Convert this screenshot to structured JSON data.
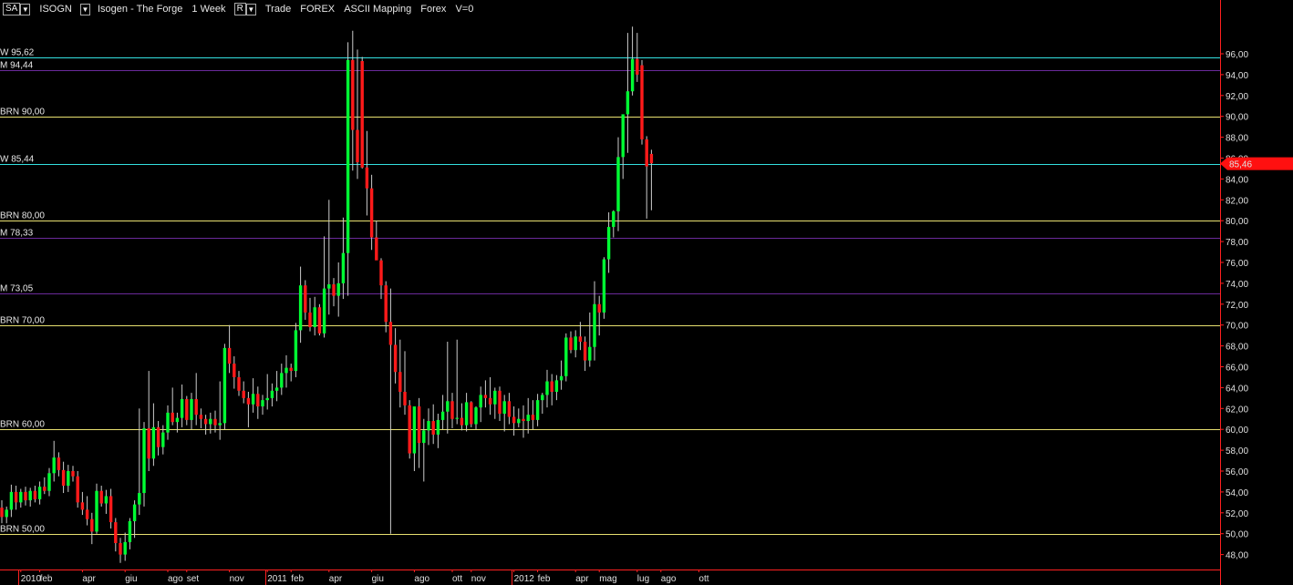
{
  "toolbar": {
    "sa_label": "SA",
    "symbol": "ISOGN",
    "description": "Isogen - The Forge",
    "period": "1 Week",
    "r_label": "R",
    "trade": "Trade",
    "market": "FOREX",
    "mapping": "ASCII Mapping",
    "forex": "Forex",
    "volume": "V=0",
    "dropdown_icon": "chevron-down-icon"
  },
  "colors": {
    "background": "#000000",
    "up_candle": "#00ff33",
    "down_candle": "#ff1a1a",
    "wick": "#cccccc",
    "weekly_level": "#33e0e0",
    "monthly_level": "#6a2a9a",
    "brn_level": "#e8e070",
    "axis": "#ff2020",
    "last_price_bg": "#ff1010"
  },
  "chart_data": {
    "type": "candlestick",
    "ylim": [
      47,
      100
    ],
    "yticks": [
      "48,00",
      "50,00",
      "52,00",
      "54,00",
      "56,00",
      "58,00",
      "60,00",
      "62,00",
      "64,00",
      "66,00",
      "68,00",
      "70,00",
      "72,00",
      "74,00",
      "76,00",
      "78,00",
      "80,00",
      "82,00",
      "84,00",
      "86,00",
      "88,00",
      "90,00",
      "92,00",
      "94,00",
      "96,00"
    ],
    "x_labels": [
      {
        "label": "2010",
        "w": 4
      },
      {
        "label": "feb",
        "w": 8
      },
      {
        "label": "apr",
        "w": 17
      },
      {
        "label": "giu",
        "w": 26
      },
      {
        "label": "ago",
        "w": 35
      },
      {
        "label": "set",
        "w": 39
      },
      {
        "label": "nov",
        "w": 48
      },
      {
        "label": "2011",
        "w": 56
      },
      {
        "label": "feb",
        "w": 61
      },
      {
        "label": "apr",
        "w": 69
      },
      {
        "label": "giu",
        "w": 78
      },
      {
        "label": "ago",
        "w": 87
      },
      {
        "label": "ott",
        "w": 95
      },
      {
        "label": "nov",
        "w": 99
      },
      {
        "label": "2012",
        "w": 108
      },
      {
        "label": "feb",
        "w": 113
      },
      {
        "label": "apr",
        "w": 121
      },
      {
        "label": "mag",
        "w": 126
      },
      {
        "label": "lug",
        "w": 134
      },
      {
        "label": "ago",
        "w": 139
      },
      {
        "label": "ott",
        "w": 147
      }
    ],
    "year_boundaries": [
      4,
      56,
      108
    ],
    "levels": [
      {
        "label": "W 95,62",
        "value": 95.62,
        "kind": "weekly"
      },
      {
        "label": "M 94,44",
        "value": 94.44,
        "kind": "monthly"
      },
      {
        "label": "BRN 90,00",
        "value": 90.0,
        "kind": "brn"
      },
      {
        "label": "W 85,44",
        "value": 85.44,
        "kind": "weekly"
      },
      {
        "label": "BRN 80,00",
        "value": 80.0,
        "kind": "brn"
      },
      {
        "label": "M 78,33",
        "value": 78.33,
        "kind": "monthly"
      },
      {
        "label": "M 73,05",
        "value": 73.05,
        "kind": "monthly"
      },
      {
        "label": "BRN 70,00",
        "value": 70.0,
        "kind": "brn"
      },
      {
        "label": "BRN 60,00",
        "value": 60.0,
        "kind": "brn"
      },
      {
        "label": "BRN 50,00",
        "value": 50.0,
        "kind": "brn"
      }
    ],
    "last_price": {
      "value": 85.46,
      "label": "85,46"
    },
    "candles": [
      {
        "o": 52.5,
        "h": 53.2,
        "l": 51.0,
        "c": 51.6
      },
      {
        "o": 51.6,
        "h": 52.6,
        "l": 51.0,
        "c": 52.3
      },
      {
        "o": 52.3,
        "h": 54.7,
        "l": 51.6,
        "c": 54.0
      },
      {
        "o": 54.0,
        "h": 54.6,
        "l": 52.3,
        "c": 53.0
      },
      {
        "o": 53.0,
        "h": 54.3,
        "l": 52.5,
        "c": 54.0
      },
      {
        "o": 54.0,
        "h": 54.5,
        "l": 52.7,
        "c": 53.2
      },
      {
        "o": 53.2,
        "h": 54.4,
        "l": 52.6,
        "c": 54.1
      },
      {
        "o": 54.1,
        "h": 54.6,
        "l": 53.0,
        "c": 53.3
      },
      {
        "o": 53.3,
        "h": 55.0,
        "l": 52.8,
        "c": 54.5
      },
      {
        "o": 54.5,
        "h": 55.4,
        "l": 53.8,
        "c": 54.1
      },
      {
        "o": 54.1,
        "h": 56.3,
        "l": 53.6,
        "c": 55.8
      },
      {
        "o": 55.8,
        "h": 58.9,
        "l": 55.0,
        "c": 57.3
      },
      {
        "o": 57.3,
        "h": 57.8,
        "l": 55.5,
        "c": 56.1
      },
      {
        "o": 56.1,
        "h": 56.9,
        "l": 53.9,
        "c": 54.6
      },
      {
        "o": 54.6,
        "h": 56.6,
        "l": 54.0,
        "c": 56.0
      },
      {
        "o": 56.0,
        "h": 56.5,
        "l": 55.0,
        "c": 55.5
      },
      {
        "o": 55.5,
        "h": 56.0,
        "l": 52.5,
        "c": 53.0
      },
      {
        "o": 53.0,
        "h": 54.0,
        "l": 51.8,
        "c": 52.3
      },
      {
        "o": 52.3,
        "h": 53.6,
        "l": 50.8,
        "c": 51.4
      },
      {
        "o": 51.4,
        "h": 52.0,
        "l": 49.0,
        "c": 50.2
      },
      {
        "o": 50.2,
        "h": 54.8,
        "l": 50.0,
        "c": 54.1
      },
      {
        "o": 54.1,
        "h": 54.6,
        "l": 52.6,
        "c": 52.9
      },
      {
        "o": 52.9,
        "h": 54.2,
        "l": 51.9,
        "c": 53.6
      },
      {
        "o": 53.6,
        "h": 54.3,
        "l": 50.5,
        "c": 51.1
      },
      {
        "o": 51.1,
        "h": 51.5,
        "l": 48.3,
        "c": 49.1
      },
      {
        "o": 49.1,
        "h": 49.6,
        "l": 47.2,
        "c": 48.0
      },
      {
        "o": 48.0,
        "h": 50.1,
        "l": 47.4,
        "c": 49.2
      },
      {
        "o": 49.2,
        "h": 51.5,
        "l": 48.5,
        "c": 51.2
      },
      {
        "o": 51.2,
        "h": 53.2,
        "l": 49.6,
        "c": 52.8
      },
      {
        "o": 52.8,
        "h": 62.0,
        "l": 51.8,
        "c": 53.9
      },
      {
        "o": 53.9,
        "h": 60.7,
        "l": 52.6,
        "c": 60.1
      },
      {
        "o": 60.1,
        "h": 65.6,
        "l": 56.0,
        "c": 57.2
      },
      {
        "o": 57.2,
        "h": 62.5,
        "l": 56.5,
        "c": 60.2
      },
      {
        "o": 60.2,
        "h": 60.8,
        "l": 57.5,
        "c": 58.3
      },
      {
        "o": 58.3,
        "h": 60.4,
        "l": 57.6,
        "c": 59.7
      },
      {
        "o": 59.7,
        "h": 62.3,
        "l": 59.0,
        "c": 61.6
      },
      {
        "o": 61.6,
        "h": 64.0,
        "l": 60.4,
        "c": 60.7
      },
      {
        "o": 60.7,
        "h": 61.6,
        "l": 59.7,
        "c": 61.1
      },
      {
        "o": 61.1,
        "h": 64.3,
        "l": 60.2,
        "c": 62.9
      },
      {
        "o": 62.9,
        "h": 63.2,
        "l": 60.4,
        "c": 60.9
      },
      {
        "o": 60.9,
        "h": 63.5,
        "l": 60.0,
        "c": 62.9
      },
      {
        "o": 62.9,
        "h": 65.4,
        "l": 60.4,
        "c": 61.4
      },
      {
        "o": 61.4,
        "h": 62.0,
        "l": 60.1,
        "c": 61.0
      },
      {
        "o": 61.0,
        "h": 61.4,
        "l": 59.5,
        "c": 60.5
      },
      {
        "o": 60.5,
        "h": 61.6,
        "l": 59.6,
        "c": 61.0
      },
      {
        "o": 61.0,
        "h": 61.8,
        "l": 59.7,
        "c": 60.4
      },
      {
        "o": 60.4,
        "h": 64.6,
        "l": 59.0,
        "c": 60.6
      },
      {
        "o": 60.6,
        "h": 68.2,
        "l": 60.0,
        "c": 67.8
      },
      {
        "o": 67.8,
        "h": 70.0,
        "l": 65.4,
        "c": 66.3
      },
      {
        "o": 66.3,
        "h": 67.0,
        "l": 63.9,
        "c": 65.0
      },
      {
        "o": 65.0,
        "h": 65.6,
        "l": 63.2,
        "c": 63.7
      },
      {
        "o": 63.7,
        "h": 64.6,
        "l": 62.5,
        "c": 63.0
      },
      {
        "o": 63.0,
        "h": 63.6,
        "l": 60.2,
        "c": 62.4
      },
      {
        "o": 62.4,
        "h": 64.9,
        "l": 61.6,
        "c": 63.4
      },
      {
        "o": 63.4,
        "h": 64.1,
        "l": 61.0,
        "c": 62.2
      },
      {
        "o": 62.2,
        "h": 63.3,
        "l": 61.4,
        "c": 62.8
      },
      {
        "o": 62.8,
        "h": 65.3,
        "l": 61.9,
        "c": 63.0
      },
      {
        "o": 63.0,
        "h": 64.4,
        "l": 62.2,
        "c": 63.7
      },
      {
        "o": 63.7,
        "h": 65.6,
        "l": 62.7,
        "c": 64.0
      },
      {
        "o": 64.0,
        "h": 66.3,
        "l": 63.3,
        "c": 65.4
      },
      {
        "o": 65.4,
        "h": 67.1,
        "l": 64.0,
        "c": 65.9
      },
      {
        "o": 65.9,
        "h": 66.3,
        "l": 64.6,
        "c": 65.6
      },
      {
        "o": 65.6,
        "h": 70.2,
        "l": 65.0,
        "c": 69.5
      },
      {
        "o": 69.5,
        "h": 75.6,
        "l": 68.3,
        "c": 73.8
      },
      {
        "o": 73.8,
        "h": 74.3,
        "l": 70.5,
        "c": 71.2
      },
      {
        "o": 71.2,
        "h": 72.6,
        "l": 69.4,
        "c": 69.8
      },
      {
        "o": 69.8,
        "h": 72.7,
        "l": 69.0,
        "c": 71.7
      },
      {
        "o": 71.7,
        "h": 72.0,
        "l": 69.0,
        "c": 69.2
      },
      {
        "o": 69.2,
        "h": 78.5,
        "l": 68.8,
        "c": 73.5
      },
      {
        "o": 73.5,
        "h": 82.0,
        "l": 71.0,
        "c": 73.9
      },
      {
        "o": 73.9,
        "h": 74.5,
        "l": 71.8,
        "c": 72.8
      },
      {
        "o": 72.8,
        "h": 76.0,
        "l": 70.8,
        "c": 74.0
      },
      {
        "o": 74.0,
        "h": 80.3,
        "l": 72.5,
        "c": 76.9
      },
      {
        "o": 76.9,
        "h": 97.1,
        "l": 72.8,
        "c": 95.4
      },
      {
        "o": 95.4,
        "h": 98.2,
        "l": 84.8,
        "c": 88.7
      },
      {
        "o": 88.7,
        "h": 96.4,
        "l": 84.0,
        "c": 85.6
      },
      {
        "o": 95.3,
        "h": 95.7,
        "l": 85.0,
        "c": 85.1
      },
      {
        "o": 85.1,
        "h": 88.6,
        "l": 80.5,
        "c": 83.1
      },
      {
        "o": 83.1,
        "h": 84.4,
        "l": 77.2,
        "c": 78.4
      },
      {
        "o": 78.4,
        "h": 80.0,
        "l": 76.5,
        "c": 76.2
      },
      {
        "o": 76.2,
        "h": 76.4,
        "l": 72.5,
        "c": 73.8
      },
      {
        "o": 73.8,
        "h": 74.2,
        "l": 69.3,
        "c": 70.3
      },
      {
        "o": 70.3,
        "h": 73.5,
        "l": 50.0,
        "c": 68.1
      },
      {
        "o": 68.1,
        "h": 69.7,
        "l": 64.4,
        "c": 65.5
      },
      {
        "o": 65.5,
        "h": 68.6,
        "l": 62.1,
        "c": 63.6
      },
      {
        "o": 63.6,
        "h": 67.5,
        "l": 61.4,
        "c": 62.3
      },
      {
        "o": 62.3,
        "h": 62.8,
        "l": 57.2,
        "c": 57.7
      },
      {
        "o": 57.7,
        "h": 62.0,
        "l": 56.0,
        "c": 62.2
      },
      {
        "o": 62.2,
        "h": 63.0,
        "l": 56.3,
        "c": 58.7
      },
      {
        "o": 58.7,
        "h": 61.0,
        "l": 55.0,
        "c": 59.9
      },
      {
        "o": 59.9,
        "h": 62.0,
        "l": 58.5,
        "c": 60.8
      },
      {
        "o": 60.8,
        "h": 62.4,
        "l": 58.6,
        "c": 59.5
      },
      {
        "o": 59.5,
        "h": 61.5,
        "l": 58.2,
        "c": 60.9
      },
      {
        "o": 60.9,
        "h": 63.3,
        "l": 60.0,
        "c": 61.7
      },
      {
        "o": 61.7,
        "h": 68.4,
        "l": 59.6,
        "c": 62.7
      },
      {
        "o": 62.7,
        "h": 63.5,
        "l": 60.1,
        "c": 61.0
      },
      {
        "o": 61.0,
        "h": 68.6,
        "l": 60.5,
        "c": 61.1
      },
      {
        "o": 61.1,
        "h": 62.5,
        "l": 59.9,
        "c": 60.4
      },
      {
        "o": 60.4,
        "h": 63.5,
        "l": 59.8,
        "c": 62.6
      },
      {
        "o": 62.6,
        "h": 62.7,
        "l": 60.2,
        "c": 60.5
      },
      {
        "o": 60.5,
        "h": 62.2,
        "l": 60.0,
        "c": 62.1
      },
      {
        "o": 62.1,
        "h": 64.1,
        "l": 60.7,
        "c": 63.3
      },
      {
        "o": 63.3,
        "h": 64.7,
        "l": 62.1,
        "c": 63.0
      },
      {
        "o": 63.0,
        "h": 65.0,
        "l": 61.4,
        "c": 62.4
      },
      {
        "o": 62.4,
        "h": 64.0,
        "l": 61.0,
        "c": 63.7
      },
      {
        "o": 63.7,
        "h": 64.1,
        "l": 60.8,
        "c": 61.5
      },
      {
        "o": 61.5,
        "h": 63.3,
        "l": 59.8,
        "c": 62.7
      },
      {
        "o": 62.7,
        "h": 63.5,
        "l": 60.5,
        "c": 61.2
      },
      {
        "o": 61.2,
        "h": 62.2,
        "l": 59.4,
        "c": 60.6
      },
      {
        "o": 60.6,
        "h": 62.0,
        "l": 60.2,
        "c": 61.0
      },
      {
        "o": 61.0,
        "h": 62.3,
        "l": 59.2,
        "c": 60.8
      },
      {
        "o": 60.8,
        "h": 63.0,
        "l": 59.6,
        "c": 61.4
      },
      {
        "o": 61.4,
        "h": 62.8,
        "l": 60.0,
        "c": 60.9
      },
      {
        "o": 60.9,
        "h": 63.4,
        "l": 60.3,
        "c": 62.8
      },
      {
        "o": 62.8,
        "h": 63.5,
        "l": 61.5,
        "c": 63.3
      },
      {
        "o": 63.3,
        "h": 65.7,
        "l": 62.1,
        "c": 64.6
      },
      {
        "o": 64.6,
        "h": 65.3,
        "l": 62.3,
        "c": 63.6
      },
      {
        "o": 63.6,
        "h": 65.2,
        "l": 62.8,
        "c": 64.7
      },
      {
        "o": 64.7,
        "h": 66.6,
        "l": 63.8,
        "c": 65.1
      },
      {
        "o": 65.1,
        "h": 69.2,
        "l": 64.6,
        "c": 68.8
      },
      {
        "o": 68.8,
        "h": 69.4,
        "l": 67.3,
        "c": 67.6
      },
      {
        "o": 67.6,
        "h": 69.5,
        "l": 66.9,
        "c": 68.9
      },
      {
        "o": 68.9,
        "h": 70.3,
        "l": 67.6,
        "c": 68.4
      },
      {
        "o": 68.4,
        "h": 68.9,
        "l": 65.6,
        "c": 66.6
      },
      {
        "o": 66.6,
        "h": 71.2,
        "l": 66.0,
        "c": 67.9
      },
      {
        "o": 67.9,
        "h": 74.2,
        "l": 66.6,
        "c": 72.0
      },
      {
        "o": 72.0,
        "h": 72.8,
        "l": 69.0,
        "c": 71.2
      },
      {
        "o": 71.2,
        "h": 76.5,
        "l": 70.6,
        "c": 76.3
      },
      {
        "o": 76.3,
        "h": 80.8,
        "l": 75.0,
        "c": 79.4
      },
      {
        "o": 79.4,
        "h": 81.0,
        "l": 78.4,
        "c": 80.9
      },
      {
        "o": 80.9,
        "h": 88.0,
        "l": 79.0,
        "c": 86.1
      },
      {
        "o": 86.1,
        "h": 90.0,
        "l": 84.0,
        "c": 90.2
      },
      {
        "o": 90.2,
        "h": 98.0,
        "l": 86.5,
        "c": 92.4
      },
      {
        "o": 92.4,
        "h": 98.6,
        "l": 92.0,
        "c": 95.5
      },
      {
        "o": 95.5,
        "h": 98.0,
        "l": 93.3,
        "c": 94.0
      },
      {
        "o": 94.9,
        "h": 95.4,
        "l": 87.3,
        "c": 87.8
      },
      {
        "o": 87.8,
        "h": 88.1,
        "l": 80.2,
        "c": 85.2
      },
      {
        "o": 86.4,
        "h": 86.8,
        "l": 81.0,
        "c": 85.5
      }
    ]
  }
}
